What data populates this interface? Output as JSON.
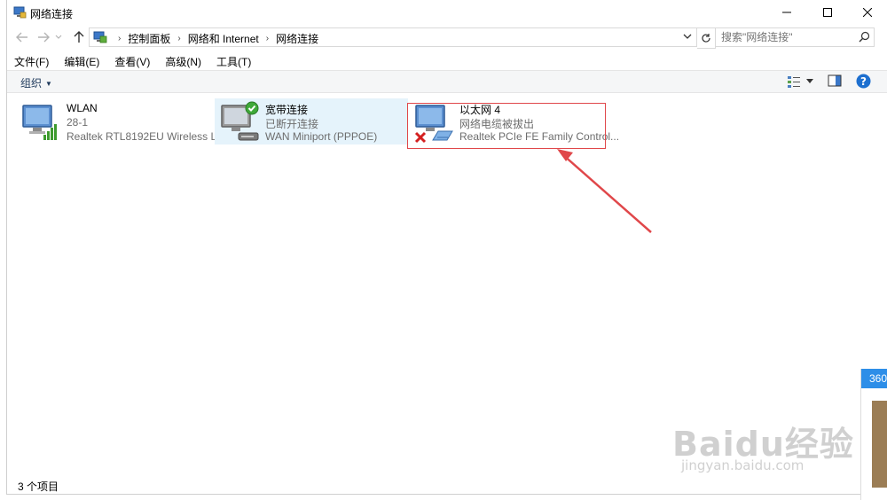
{
  "window": {
    "title": "网络连接",
    "minimize": "minimize",
    "maximize": "maximize",
    "close": "close"
  },
  "address": {
    "crumbs": [
      "控制面板",
      "网络和 Internet",
      "网络连接"
    ],
    "search_placeholder": "搜索\"网络连接\""
  },
  "menu": [
    "文件(F)",
    "编辑(E)",
    "查看(V)",
    "高级(N)",
    "工具(T)"
  ],
  "commandbar": {
    "organize": "组织"
  },
  "connections": [
    {
      "name": "WLAN",
      "status": "28-1",
      "device": "Realtek RTL8192EU Wireless L...",
      "icon": "wifi-adapter-icon"
    },
    {
      "name": "宽带连接",
      "status": "已断开连接",
      "device": "WAN Miniport (PPPOE)",
      "icon": "broadband-connection-icon"
    },
    {
      "name": "以太网 4",
      "status": "网络电缆被拔出",
      "device": "Realtek PCIe FE Family Control...",
      "icon": "ethernet-disconnected-icon"
    }
  ],
  "statusbar": {
    "count": "3 个项目"
  },
  "popup": {
    "label": "360"
  },
  "watermark": {
    "logo": "Baidu经验",
    "url": "jingyan.baidu.com"
  },
  "colors": {
    "accent": "#2d8ee8",
    "selection": "#e5f3fb",
    "highlight_box": "#e0474a"
  }
}
